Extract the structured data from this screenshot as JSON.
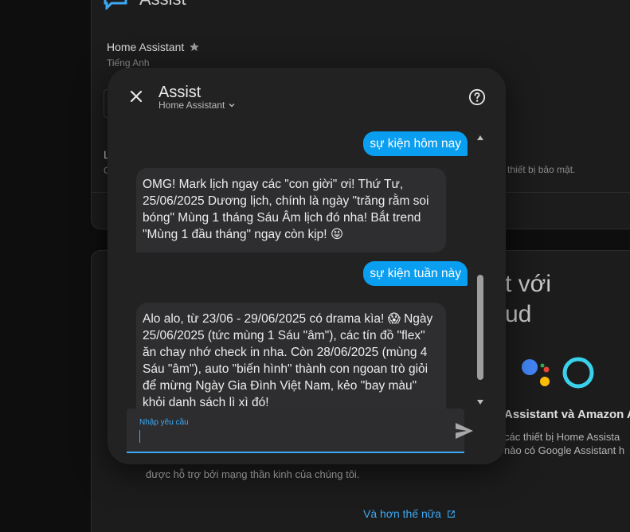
{
  "background": {
    "title": "Assist",
    "pipeline_name": "Home Assistant",
    "pipeline_language": "Tiếng Anh",
    "section_letter": "L",
    "section_letter2": "C",
    "security_text": "à thiết bị bảo mật.",
    "cloud_heading_line1": "t với",
    "cloud_heading_line2": "ud",
    "assistants_heading": "Assistant và Amazon A",
    "assistants_text1": "các thiết bị Home Assista",
    "assistants_text2": "nào có Google Assistant h",
    "neural_text": "được hỗ trợ bởi mạng thần kinh của chúng tôi.",
    "more_link": "Và hơn thế nữa"
  },
  "dialog": {
    "title": "Assist",
    "pipeline": "Home Assistant",
    "messages": [
      {
        "from": "user",
        "text": "sự kiện hôm nay"
      },
      {
        "from": "bot",
        "text": "OMG! Mark lịch ngay các \"con giời\" ơi! Thứ Tư, 25/06/2025 Dương lịch, chính là ngày \"trăng rằm soi bóng\" Mùng 1 tháng Sáu Âm lịch đó nha! Bắt trend \"Mùng 1 đầu tháng\" ngay còn kịp! 😝"
      },
      {
        "from": "user",
        "text": "sự kiện tuần này"
      },
      {
        "from": "bot",
        "text": "Alo alo, từ 23/06 - 29/06/2025 có drama kìa! 😱 Ngày 25/06/2025 (tức mùng 1 Sáu \"âm\"), các tín đồ \"flex\" ăn chay nhớ check in nha. Còn 28/06/2025 (mùng 4 Sáu \"âm\"), auto \"biến hình\" thành con ngoan trò giỏi để mừng Ngày Gia Đình Việt Nam, kẻo \"bay màu\" khỏi danh sách lì xì đó!"
      }
    ],
    "input_label": "Nhập yêu cầu",
    "input_value": ""
  },
  "colors": {
    "accent": "#3da9f4",
    "user_bubble": "#0a9ef0",
    "bot_bubble": "#2e2e30",
    "dialog_bg": "#222223"
  }
}
